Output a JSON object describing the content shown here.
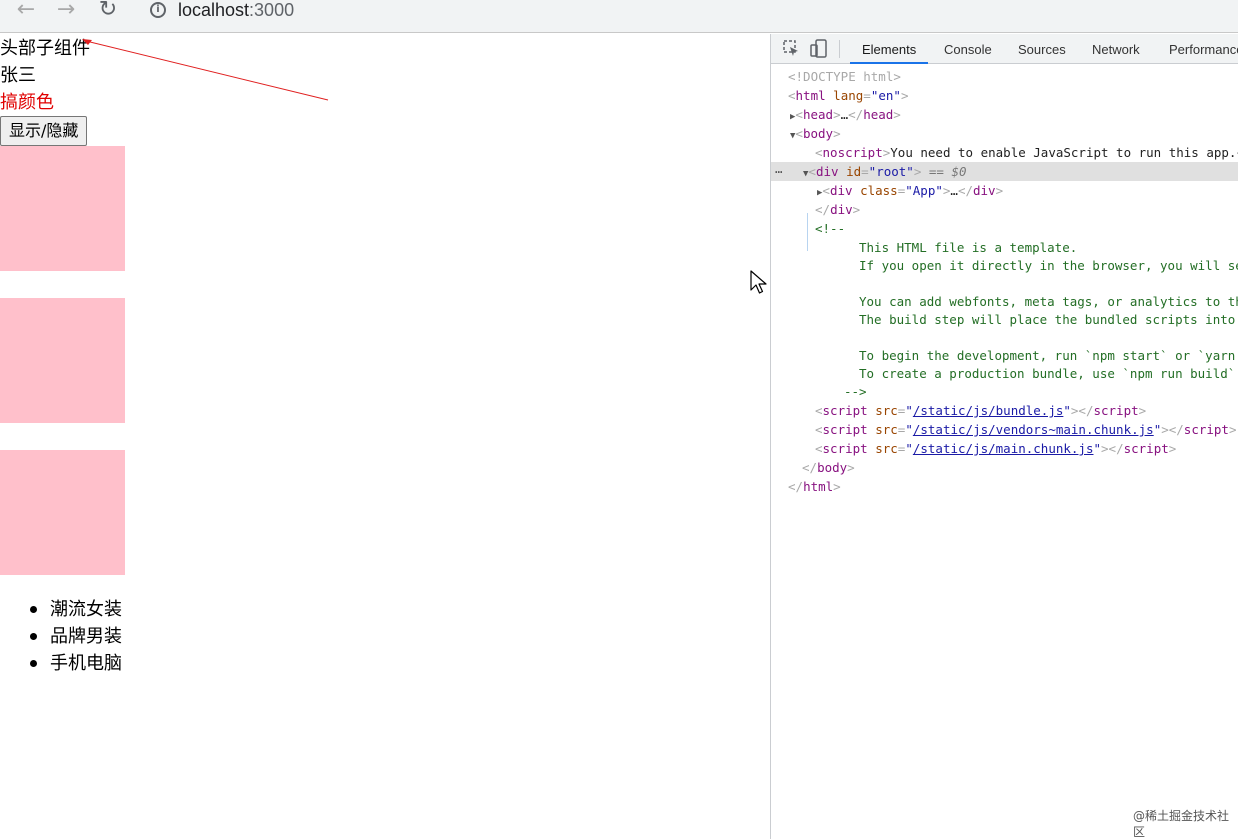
{
  "browser": {
    "url_host": "localhost",
    "url_port": ":3000"
  },
  "page": {
    "header_text": "头部子组件",
    "name_text": "张三",
    "color_text": "搞颜色",
    "toggle_button": "显示/隐藏",
    "box_color": "#ffc0cb",
    "list": [
      "潮流女装",
      "品牌男装",
      "手机电脑"
    ]
  },
  "devtools": {
    "tabs": [
      "Elements",
      "Console",
      "Sources",
      "Network",
      "Performance"
    ],
    "active_tab": "Elements",
    "doctype": "<!DOCTYPE html>",
    "html_lang": "en",
    "head_collapsed": "…",
    "noscript_text": "You need to enable JavaScript to run this app.",
    "root_id": "root",
    "selected_marker": "== $0",
    "app_class": "App",
    "comment_lines": [
      "This HTML file is a template.",
      "If you open it directly in the browser, you will se",
      "",
      "You can add webfonts, meta tags, or analytics to th",
      "The build step will place the bundled scripts into",
      "",
      "To begin the development, run `npm start` or `yarn",
      "To create a production bundle, use `npm run build`"
    ],
    "scripts": [
      "/static/js/bundle.js",
      "/static/js/vendors~main.chunk.js",
      "/static/js/main.chunk.js"
    ]
  },
  "watermark": "@稀土掘金技术社区"
}
